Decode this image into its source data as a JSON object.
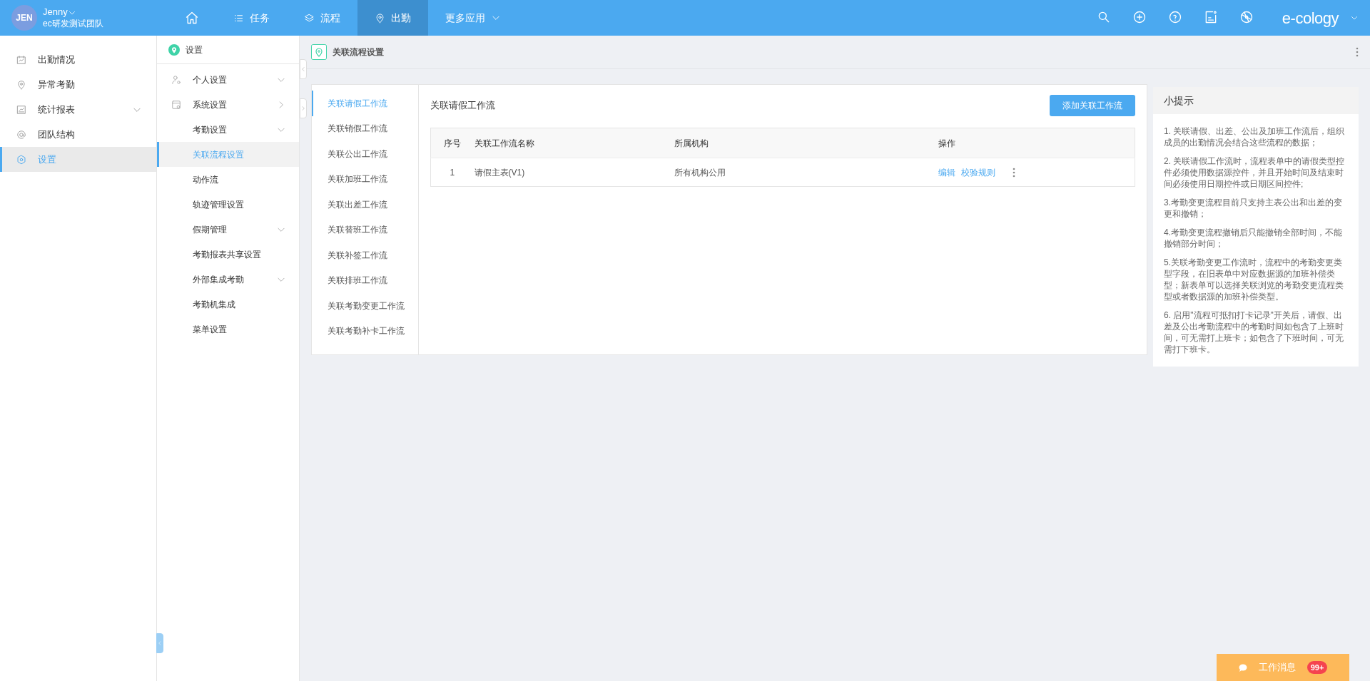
{
  "user": {
    "avatar": "JEN",
    "name": "Jenny",
    "team": "ec研发测试团队"
  },
  "nav": [
    {
      "kind": "home",
      "selected": false
    },
    {
      "kind": "list",
      "label": "任务",
      "selected": false
    },
    {
      "kind": "layers",
      "label": "流程",
      "selected": false
    },
    {
      "kind": "pin",
      "label": "出勤",
      "selected": true
    },
    {
      "kind": "more",
      "label": "更多应用",
      "selected": false
    }
  ],
  "brand": "e-cology",
  "sidebar": {
    "items": [
      {
        "label": "出勤情况",
        "selected": false
      },
      {
        "label": "异常考勤",
        "selected": false
      },
      {
        "label": "统计报表",
        "selected": false,
        "expanded": true
      },
      {
        "label": "团队结构",
        "selected": false
      },
      {
        "label": "设置",
        "selected": true
      }
    ]
  },
  "submenu": {
    "title": "设置",
    "items": [
      {
        "label": "个人设置",
        "selected": false,
        "expanded": true
      },
      {
        "label": "系统设置",
        "selected": false,
        "expanded": false
      },
      {
        "label": "考勤设置",
        "selected": false,
        "expanded": true
      },
      {
        "label": "关联流程设置",
        "selected": true
      },
      {
        "label": "动作流",
        "selected": false
      },
      {
        "label": "轨迹管理设置",
        "selected": false
      },
      {
        "label": "假期管理",
        "selected": false,
        "expanded": true
      },
      {
        "label": "考勤报表共享设置",
        "selected": false
      },
      {
        "label": "外部集成考勤",
        "selected": false,
        "expanded": true
      },
      {
        "label": "考勤机集成",
        "selected": false
      },
      {
        "label": "菜单设置",
        "selected": false
      }
    ]
  },
  "breadcrumb": "关联流程设置",
  "tabs": [
    {
      "label": "关联请假工作流",
      "selected": true
    },
    {
      "label": "关联销假工作流",
      "selected": false
    },
    {
      "label": "关联公出工作流",
      "selected": false
    },
    {
      "label": "关联加班工作流",
      "selected": false
    },
    {
      "label": "关联出差工作流",
      "selected": false
    },
    {
      "label": "关联替班工作流",
      "selected": false
    },
    {
      "label": "关联补签工作流",
      "selected": false
    },
    {
      "label": "关联排班工作流",
      "selected": false
    },
    {
      "label": "关联考勤变更工作流",
      "selected": false
    },
    {
      "label": "关联考勤补卡工作流",
      "selected": false
    }
  ],
  "panel": {
    "title": "关联请假工作流",
    "add_button": "添加关联工作流",
    "table": {
      "columns": [
        "序号",
        "关联工作流名称",
        "所属机构",
        "操作"
      ],
      "rows": [
        {
          "index": "1",
          "name": "请假主表(V1)",
          "org": "所有机构公用",
          "actions": [
            "编辑",
            "校验规则"
          ]
        }
      ]
    }
  },
  "tips": {
    "title": "小提示",
    "items": [
      "1. 关联请假、出差、公出及加班工作流后，组织成员的出勤情况会结合这些流程的数据；",
      "2. 关联请假工作流时，流程表单中的请假类型控件必须使用数据源控件，并且开始时间及结束时间必须使用日期控件或日期区间控件;",
      "3.考勤变更流程目前只支持主表公出和出差的变更和撤销；",
      "4.考勤变更流程撤销后只能撤销全部时间，不能撤销部分时间；",
      "5.关联考勤变更工作流时，流程中的考勤变更类型字段，在旧表单中对应数据源的加班补偿类型；新表单可以选择关联浏览的考勤变更流程类型或者数据源的加班补偿类型。",
      "6. 启用\"流程可抵扣打卡记录\"开关后，请假、出差及公出考勤流程中的考勤时间如包含了上班时间，可无需打上班卡；如包含了下班时间，可无需打下班卡。"
    ]
  },
  "message": {
    "label": "工作消息",
    "badge": "99+"
  }
}
